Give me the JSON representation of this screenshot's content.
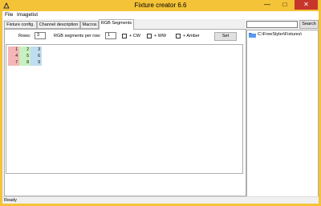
{
  "window": {
    "title": "Fixture creator 6.6"
  },
  "menu": {
    "items": [
      "File",
      "Imagelist"
    ]
  },
  "tabs": [
    "Fixture config.",
    "Channel description",
    "Macros",
    "RGB Segments"
  ],
  "rgb_segments": {
    "rows_label": "Rows:",
    "rows_value": "3",
    "segments_label": "RGB segments per row:",
    "segments_value": "1",
    "options": [
      "+ CW",
      "+ WW",
      "+ Amber"
    ],
    "set_label": "Set",
    "grid": [
      [
        "1",
        "2",
        "3"
      ],
      [
        "4",
        "5",
        "6"
      ],
      [
        "7",
        "8",
        "9"
      ]
    ],
    "column_colors": [
      "#f4b6b6",
      "#c8f0c0",
      "#c0dcf0"
    ]
  },
  "search": {
    "button_label": "Search",
    "value": ""
  },
  "tree": {
    "root": "C:\\FreeStyler\\Fixtures\\"
  },
  "status": {
    "text": "Ready"
  },
  "colors": {
    "frame": "#f4c338",
    "close": "#c7362b"
  }
}
